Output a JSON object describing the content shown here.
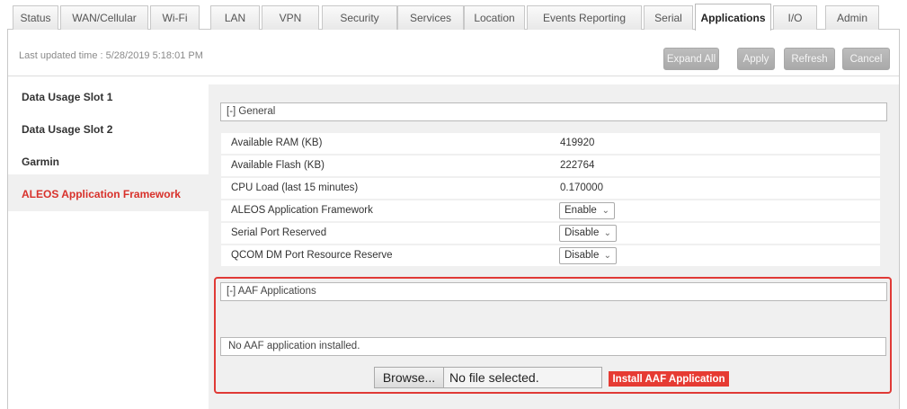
{
  "tabs": [
    {
      "label": "Status"
    },
    {
      "label": "WAN/Cellular"
    },
    {
      "label": "Wi-Fi"
    },
    {
      "label": "LAN"
    },
    {
      "label": "VPN"
    },
    {
      "label": "Security"
    },
    {
      "label": "Services"
    },
    {
      "label": "Location"
    },
    {
      "label": "Events Reporting"
    },
    {
      "label": "Serial"
    },
    {
      "label": "Applications"
    },
    {
      "label": "I/O"
    },
    {
      "label": "Admin"
    }
  ],
  "active_tab": "Applications",
  "status": {
    "last_updated": "Last updated time : 5/28/2019 5:18:01 PM"
  },
  "toolbar": {
    "expand_all": "Expand All",
    "apply": "Apply",
    "refresh": "Refresh",
    "cancel": "Cancel"
  },
  "sidebar": {
    "items": [
      {
        "label": "Data Usage Slot 1"
      },
      {
        "label": "Data Usage Slot 2"
      },
      {
        "label": "Garmin"
      },
      {
        "label": "ALEOS Application Framework"
      }
    ],
    "active": "ALEOS Application Framework"
  },
  "general": {
    "header": "[-] General",
    "rows": [
      {
        "label": "Available RAM (KB)",
        "value": "419920"
      },
      {
        "label": "Available Flash (KB)",
        "value": "222764"
      },
      {
        "label": "CPU Load (last 15 minutes)",
        "value": "0.170000"
      },
      {
        "label": "ALEOS Application Framework",
        "value": "Enable"
      },
      {
        "label": "Serial Port Reserved",
        "value": "Disable"
      },
      {
        "label": "QCOM DM Port Resource Reserve",
        "value": "Disable"
      }
    ]
  },
  "aaf": {
    "header": "[-] AAF Applications",
    "no_app": "No AAF application installed.",
    "browse_label": "Browse...",
    "file_status": "No file selected.",
    "install_label": "Install AAF Application"
  },
  "colors": {
    "accent_red": "#e63b33",
    "panel_bg": "#f0f0f0",
    "highlight_border": "#e03a36"
  }
}
